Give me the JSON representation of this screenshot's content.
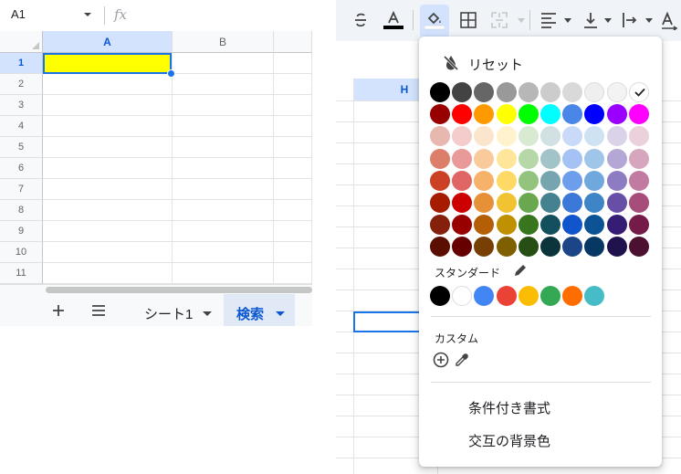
{
  "left_sheet": {
    "namebox": "A1",
    "fx_label": "fx",
    "columns": [
      "A",
      "B"
    ],
    "rows": [
      "1",
      "2",
      "3",
      "4",
      "5",
      "6",
      "7",
      "8",
      "9",
      "10",
      "11"
    ],
    "selected_cell_color": "#ffff00",
    "tabs": [
      {
        "label": "シート1",
        "active": false
      },
      {
        "label": "検索",
        "active": true
      }
    ]
  },
  "right_sheet": {
    "column_header": "H",
    "toolbar_icons": [
      "strikethrough-icon",
      "text-color-icon",
      "fill-color-icon",
      "borders-icon",
      "merge-cells-icon",
      "horizontal-align-icon",
      "vertical-align-icon",
      "text-wrapping-icon",
      "text-rotation-icon"
    ],
    "text_color_underline": "#000000"
  },
  "color_picker": {
    "reset_label": "リセット",
    "standard_label": "スタンダード",
    "custom_label": "カスタム",
    "conditional_format_label": "条件付き書式",
    "alternating_colors_label": "交互の背景色",
    "selected_color": "#ffffff",
    "palette": [
      [
        "#000000",
        "#434343",
        "#666666",
        "#999999",
        "#b7b7b7",
        "#cccccc",
        "#d9d9d9",
        "#efefef",
        "#f3f3f3",
        "#ffffff"
      ],
      [
        "#980000",
        "#ff0000",
        "#ff9900",
        "#ffff00",
        "#00ff00",
        "#00ffff",
        "#4a86e8",
        "#0000ff",
        "#9900ff",
        "#ff00ff"
      ],
      [
        "#e6b8af",
        "#f4cccc",
        "#fce5cd",
        "#fff2cc",
        "#d9ead3",
        "#d0e0e3",
        "#c9daf8",
        "#cfe2f3",
        "#d9d2e9",
        "#ead1dc"
      ],
      [
        "#dd7e6b",
        "#ea9999",
        "#f9cb9c",
        "#ffe599",
        "#b6d7a8",
        "#a2c4c9",
        "#a4c2f4",
        "#9fc5e8",
        "#b4a7d6",
        "#d5a6bd"
      ],
      [
        "#cc4125",
        "#e06666",
        "#f6b26b",
        "#ffd966",
        "#93c47d",
        "#76a5af",
        "#6d9eeb",
        "#6fa8dc",
        "#8e7cc3",
        "#c27ba0"
      ],
      [
        "#a61c00",
        "#cc0000",
        "#e69138",
        "#f1c232",
        "#6aa84f",
        "#45818e",
        "#3c78d8",
        "#3d85c6",
        "#674ea7",
        "#a64d79"
      ],
      [
        "#85200c",
        "#990000",
        "#b45f06",
        "#bf9000",
        "#38761d",
        "#134f5c",
        "#1155cc",
        "#0b5394",
        "#351c75",
        "#741b47"
      ],
      [
        "#5b0f00",
        "#660000",
        "#783f04",
        "#7f6000",
        "#274e13",
        "#0c343d",
        "#1c4587",
        "#073763",
        "#20124d",
        "#4c1130"
      ]
    ],
    "standard_colors": [
      "#000000",
      "#ffffff",
      "#4285f4",
      "#ea4335",
      "#fbbc04",
      "#34a853",
      "#ff6d01",
      "#46bdc6"
    ]
  }
}
